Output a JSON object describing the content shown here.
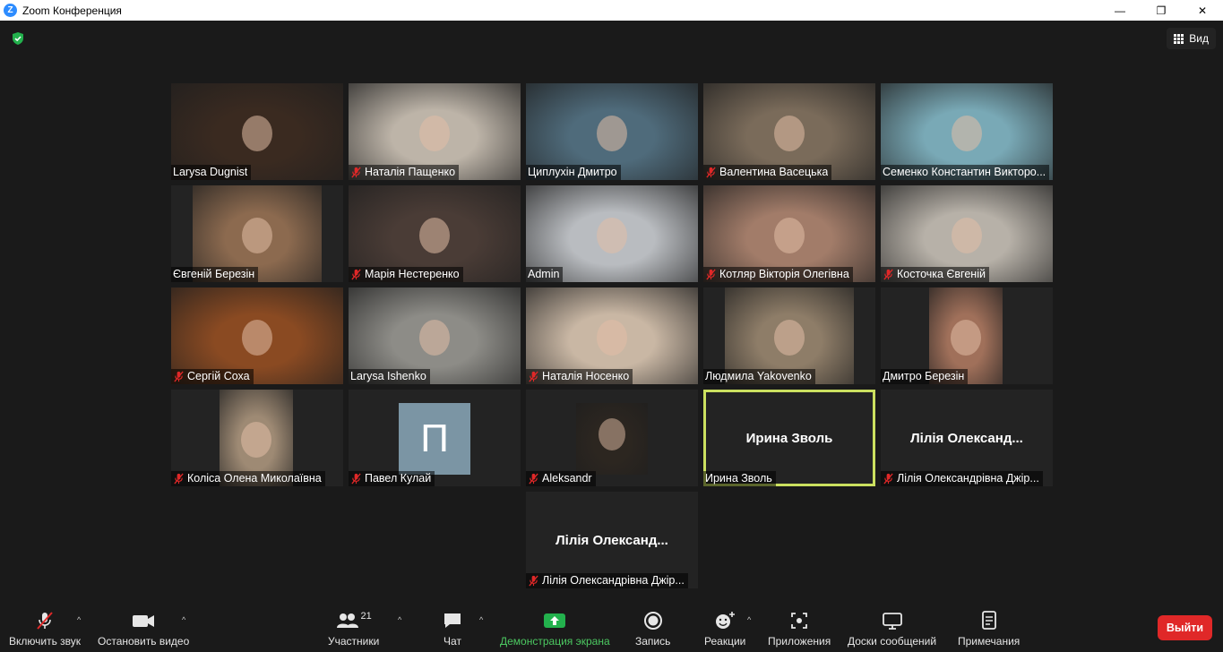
{
  "window": {
    "title": "Zoom Конференция",
    "app_icon": "zoom-icon",
    "minimize_glyph": "—",
    "restore_glyph": "❐",
    "close_glyph": "✕"
  },
  "topbar": {
    "security_icon": "shield-check-icon",
    "security_color": "#23b14d",
    "view_label": "Вид"
  },
  "participants": [
    {
      "name": "Larysa Dugnist",
      "muted": false,
      "tint": "#3a2a20"
    },
    {
      "name": "Наталія Пащенко",
      "muted": true,
      "tint": "#bdb4a8"
    },
    {
      "name": "Циплухін Дмитро",
      "muted": false,
      "tint": "#4f6b7b"
    },
    {
      "name": "Валентина Васецька",
      "muted": true,
      "tint": "#7a6b5a"
    },
    {
      "name": "Семенко Константин Викторо...",
      "muted": false,
      "tint": "#79a9b6"
    },
    {
      "name": "Євгеній Березін",
      "muted": false,
      "tint": "#8c6a4f"
    },
    {
      "name": "Марія Нестеренко",
      "muted": true,
      "tint": "#4a3c36"
    },
    {
      "name": "Admin",
      "muted": false,
      "tint": "#b9bcc0"
    },
    {
      "name": "Котляр Вікторія Олегівна",
      "muted": true,
      "tint": "#a27c69"
    },
    {
      "name": "Косточка Євгеній",
      "muted": true,
      "tint": "#b7b1a8"
    },
    {
      "name": "Сергій Соха",
      "muted": true,
      "tint": "#8a4a22"
    },
    {
      "name": "Larysa Ishenko",
      "muted": false,
      "tint": "#8d8c87"
    },
    {
      "name": "Наталія Носенко",
      "muted": true,
      "tint": "#c9b7a4"
    },
    {
      "name": "Людмила Yakovenko",
      "muted": false,
      "tint": "#8e7d68"
    },
    {
      "name": "Дмитро Березін",
      "muted": false,
      "tint": "#a0705a"
    },
    {
      "name": "Коліса Олена Миколаївна",
      "muted": true,
      "tint": "#9e8a74"
    },
    {
      "name": "Павел Кулай",
      "muted": true,
      "avatar_letter": "П",
      "avatar_color": "#7b95a4"
    },
    {
      "name": "Aleksandr",
      "muted": true,
      "tint": "#2c2620"
    },
    {
      "name": "Ирина Зволь",
      "muted": false,
      "center_name": "Ирина Зволь",
      "active": true,
      "active_color": "#cbe05f"
    },
    {
      "name": "Лілія Олександрівна Джір...",
      "muted": true,
      "center_name": "Лілія  Олександ..."
    },
    {
      "name": "Лілія Олександрівна Джір...",
      "muted": true,
      "center_name": "Лілія  Олександ..."
    }
  ],
  "toolbar": {
    "unmute": {
      "label": "Включить звук",
      "icon": "microphone-muted-icon"
    },
    "video": {
      "label": "Остановить видео",
      "icon": "video-camera-icon"
    },
    "participants": {
      "label": "Участники",
      "icon": "participants-icon",
      "count": "21"
    },
    "chat": {
      "label": "Чат",
      "icon": "chat-icon"
    },
    "share": {
      "label": "Демонстрация экрана",
      "icon": "share-screen-icon",
      "color": "#4cc861"
    },
    "record": {
      "label": "Запись",
      "icon": "record-icon"
    },
    "reactions": {
      "label": "Реакции",
      "icon": "emoji-reaction-icon"
    },
    "apps": {
      "label": "Приложения",
      "icon": "apps-icon"
    },
    "whiteboards": {
      "label": "Доски сообщений",
      "icon": "whiteboard-icon"
    },
    "notes": {
      "label": "Примечания",
      "icon": "notes-icon"
    },
    "leave": {
      "label": "Выйти",
      "color": "#e02828"
    },
    "caret_glyph": "^"
  }
}
